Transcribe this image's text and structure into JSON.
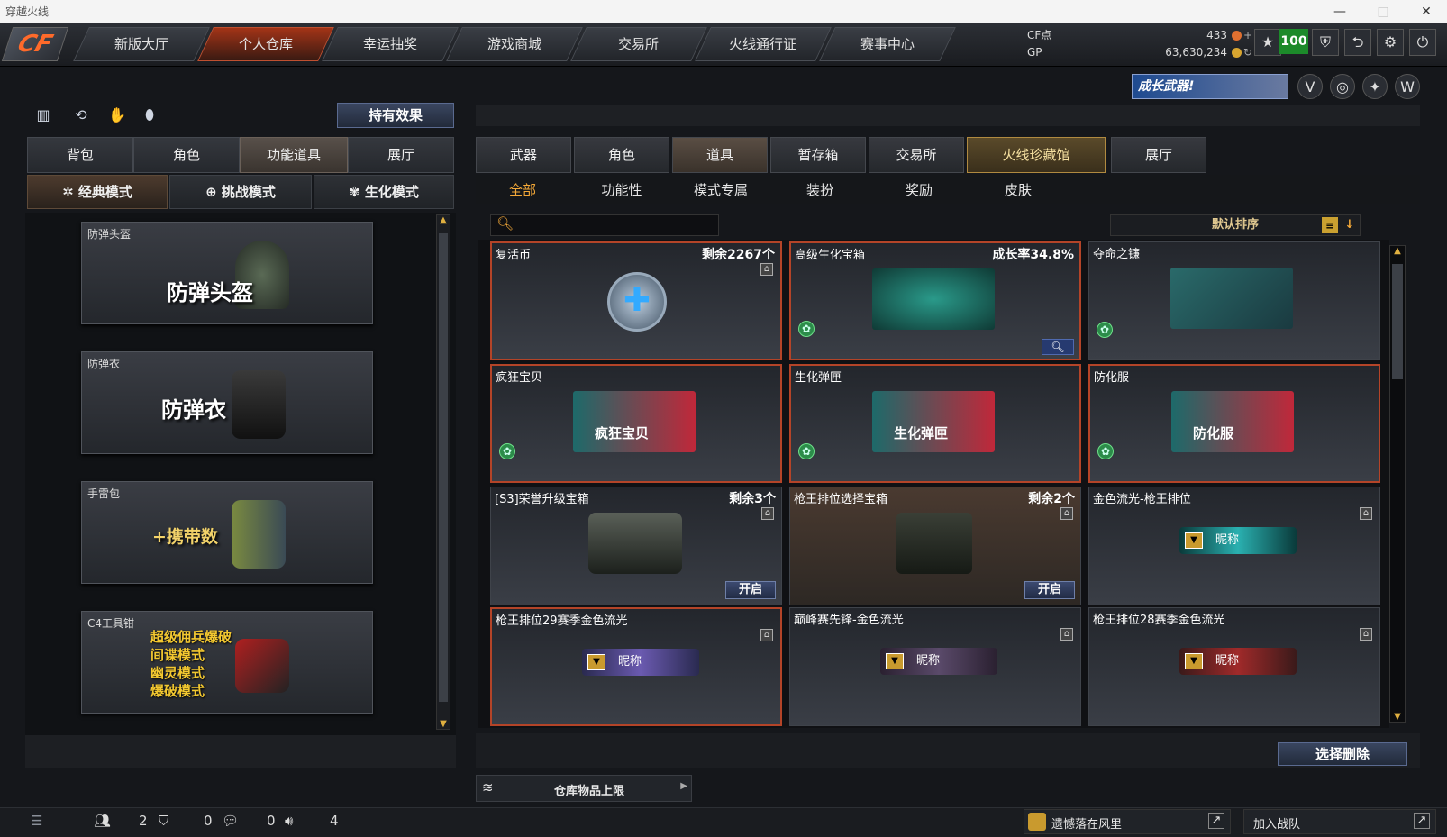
{
  "window": {
    "title": "穿越火线"
  },
  "nav": {
    "items": [
      "新版大厅",
      "个人仓库",
      "幸运抽奖",
      "游戏商城",
      "交易所",
      "火线通行证",
      "赛事中心"
    ],
    "active_index": 1
  },
  "currency": {
    "cf_label": "CF点",
    "cf_value": "433",
    "gp_label": "GP",
    "gp_value": "63,630,234"
  },
  "level": "100",
  "promo": "成长武器!",
  "left": {
    "hold_effect_btn": "持有效果",
    "tabs": [
      "背包",
      "角色",
      "功能道具",
      "展厅"
    ],
    "active_tab": 2,
    "mode_tabs": [
      "经典模式",
      "挑战模式",
      "生化模式"
    ],
    "active_mode": 0,
    "cards": [
      {
        "caption": "防弹头盔",
        "big": "防弹头盔"
      },
      {
        "caption": "防弹衣",
        "big": "防弹衣"
      },
      {
        "caption": "手雷包",
        "big": "+携带数"
      },
      {
        "caption": "C4工具钳",
        "lines": [
          "超级佣兵爆破",
          "间谍模式",
          "幽灵模式",
          "爆破模式"
        ]
      }
    ]
  },
  "right": {
    "tabs": [
      "武器",
      "角色",
      "道具",
      "暂存箱",
      "交易所",
      "火线珍藏馆",
      "展厅"
    ],
    "active_tab": 2,
    "filters": [
      "全部",
      "功能性",
      "模式专属",
      "装扮",
      "奖励",
      "皮肤"
    ],
    "active_filter": 0,
    "sort_label": "默认排序",
    "items": [
      {
        "name": "复活币",
        "tag": "剩余2267个"
      },
      {
        "name": "高级生化宝箱",
        "tag": "成长率34.8%"
      },
      {
        "name": "夺命之镰",
        "tag": ""
      },
      {
        "name": "疯狂宝贝",
        "tag": "",
        "art_text": "疯狂宝贝"
      },
      {
        "name": "生化弹匣",
        "tag": "",
        "art_text": "生化弹匣"
      },
      {
        "name": "防化服",
        "tag": "",
        "art_text": "防化服"
      },
      {
        "name": "[S3]荣誉升级宝箱",
        "tag": "剩余3个",
        "btn": "开启"
      },
      {
        "name": "枪王排位选择宝箱",
        "tag": "剩余2个",
        "btn": "开启"
      },
      {
        "name": "金色流光-枪王排位",
        "tag": "",
        "plate": "昵称"
      },
      {
        "name": "枪王排位29赛季金色流光",
        "tag": "",
        "plate": "昵称"
      },
      {
        "name": "巅峰赛先锋-金色流光",
        "tag": "",
        "plate": "昵称"
      },
      {
        "name": "枪王排位28赛季金色流光",
        "tag": "",
        "plate": "昵称"
      }
    ],
    "delete_btn": "选择删除",
    "capacity_label": "仓库物品上限"
  },
  "status": {
    "count1": "2",
    "count2": "0",
    "count3": "0",
    "count4": "4",
    "friend_name": "遗憾落在风里",
    "join_team": "加入战队"
  },
  "colors": {
    "accent": "#f3a838",
    "highlight_border": "#b44428",
    "bio_green": "#2c8c4a"
  }
}
